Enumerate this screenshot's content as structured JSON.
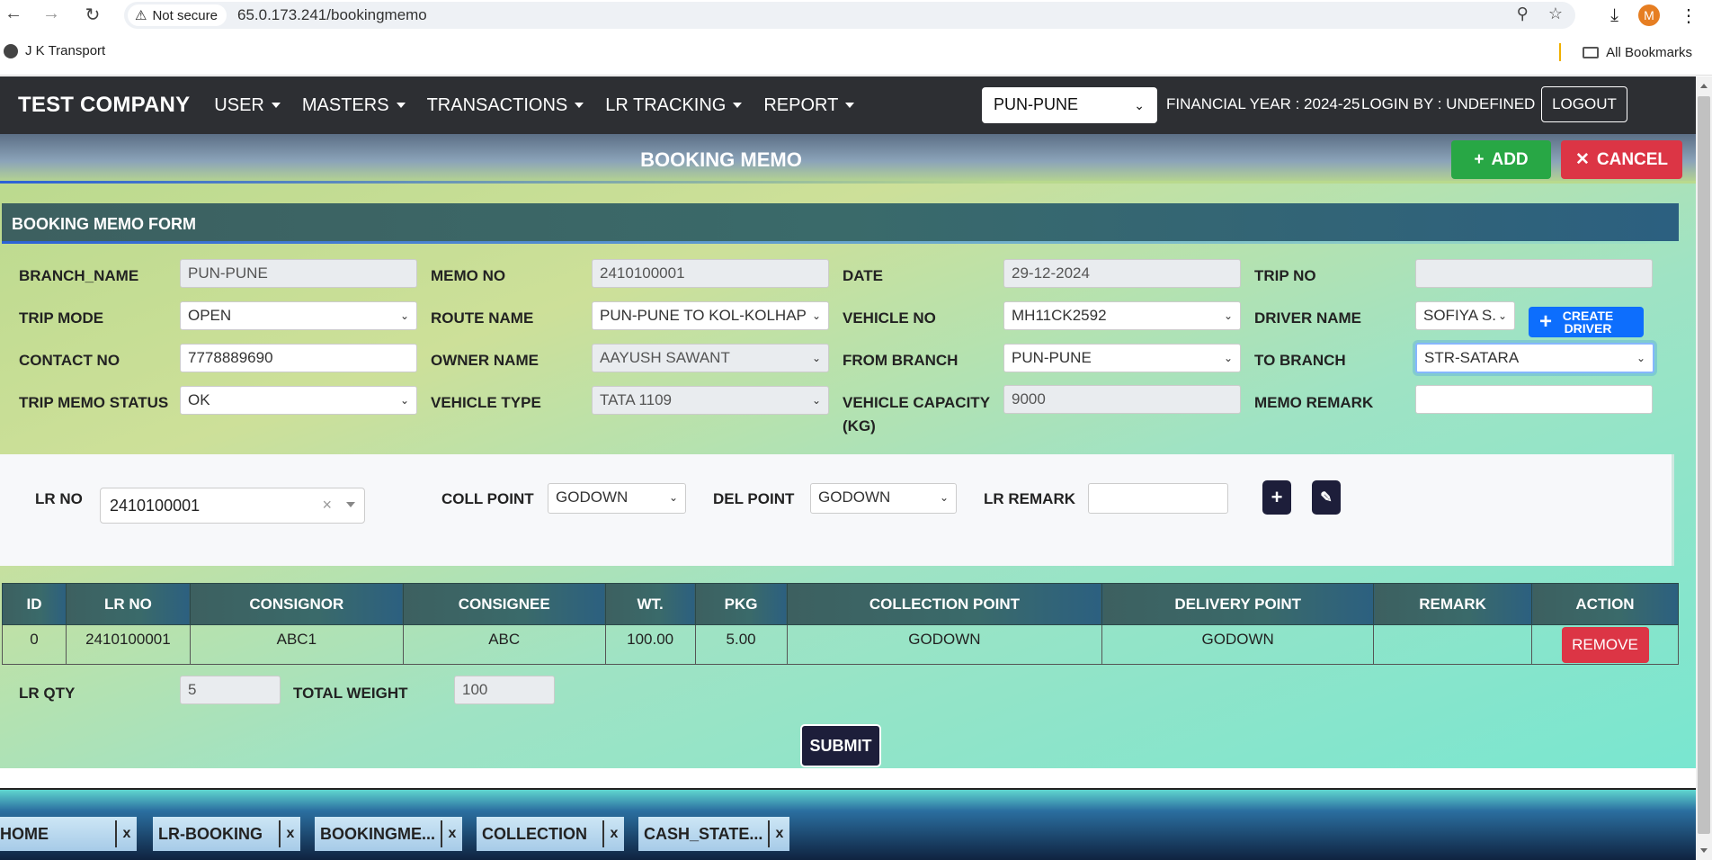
{
  "browser": {
    "security_label": "Not secure",
    "url": "65.0.173.241/bookingmemo",
    "bookmark": "J K Transport",
    "all_bookmarks": "All Bookmarks",
    "profile_initial": "M"
  },
  "navbar": {
    "brand": "TEST COMPANY",
    "menu": [
      "USER",
      "MASTERS",
      "TRANSACTIONS",
      "LR TRACKING",
      "REPORT"
    ],
    "branch": "PUN-PUNE",
    "financial_year": "FINANCIAL YEAR : 2024-25",
    "login_by": "LOGIN BY : UNDEFINED",
    "logout": "LOGOUT"
  },
  "page": {
    "title": "BOOKING MEMO",
    "add_label": "ADD",
    "cancel_label": "CANCEL",
    "form_title": "BOOKING MEMO FORM"
  },
  "form": {
    "branch_name": {
      "label": "BRANCH_NAME",
      "value": "PUN-PUNE"
    },
    "memo_no": {
      "label": "MEMO NO",
      "value": "2410100001"
    },
    "date": {
      "label": "DATE",
      "value": "29-12-2024"
    },
    "trip_no": {
      "label": "TRIP NO",
      "value": ""
    },
    "trip_mode": {
      "label": "TRIP MODE",
      "value": "OPEN"
    },
    "route_name": {
      "label": "ROUTE NAME",
      "value": "PUN-PUNE TO KOL-KOLHAP"
    },
    "vehicle_no": {
      "label": "VEHICLE NO",
      "value": "MH11CK2592"
    },
    "driver_name": {
      "label": "DRIVER NAME",
      "value": "SOFIYA S."
    },
    "create_driver": "CREATE DRIVER",
    "contact_no": {
      "label": "CONTACT NO",
      "value": "7778889690"
    },
    "owner_name": {
      "label": "OWNER NAME",
      "value": "AAYUSH SAWANT"
    },
    "from_branch": {
      "label": "FROM BRANCH",
      "value": "PUN-PUNE"
    },
    "to_branch": {
      "label": "TO BRANCH",
      "value": "STR-SATARA"
    },
    "trip_memo_status": {
      "label": "TRIP MEMO STATUS",
      "value": "OK"
    },
    "vehicle_type": {
      "label": "VEHICLE TYPE",
      "value": "TATA 1109"
    },
    "vehicle_capacity": {
      "label": "VEHICLE CAPACITY",
      "label2": "(KG)",
      "value": "9000"
    },
    "memo_remark": {
      "label": "MEMO REMARK",
      "value": ""
    }
  },
  "lr_entry": {
    "lr_no_label": "LR NO",
    "lr_no_value": "2410100001",
    "coll_point_label": "COLL POINT",
    "coll_point_value": "GODOWN",
    "del_point_label": "DEL POINT",
    "del_point_value": "GODOWN",
    "lr_remark_label": "LR REMARK",
    "lr_remark_value": ""
  },
  "table": {
    "headers": [
      "ID",
      "LR NO",
      "CONSIGNOR",
      "CONSIGNEE",
      "WT.",
      "PKG",
      "COLLECTION POINT",
      "DELIVERY POINT",
      "REMARK",
      "ACTION"
    ],
    "rows": [
      {
        "id": "0",
        "lr_no": "2410100001",
        "consignor": "ABC1",
        "consignee": "ABC",
        "wt": "100.00",
        "pkg": "5.00",
        "collection": "GODOWN",
        "delivery": "GODOWN",
        "remark": "",
        "action": "REMOVE"
      }
    ]
  },
  "totals": {
    "lr_qty_label": "LR QTY",
    "lr_qty_value": "5",
    "total_weight_label": "TOTAL WEIGHT",
    "total_weight_value": "100"
  },
  "submit_label": "SUBMIT",
  "tabs": [
    "HOME",
    "LR-BOOKING",
    "BOOKINGME...",
    "COLLECTION",
    "CASH_STATE..."
  ],
  "tab_close": "x"
}
